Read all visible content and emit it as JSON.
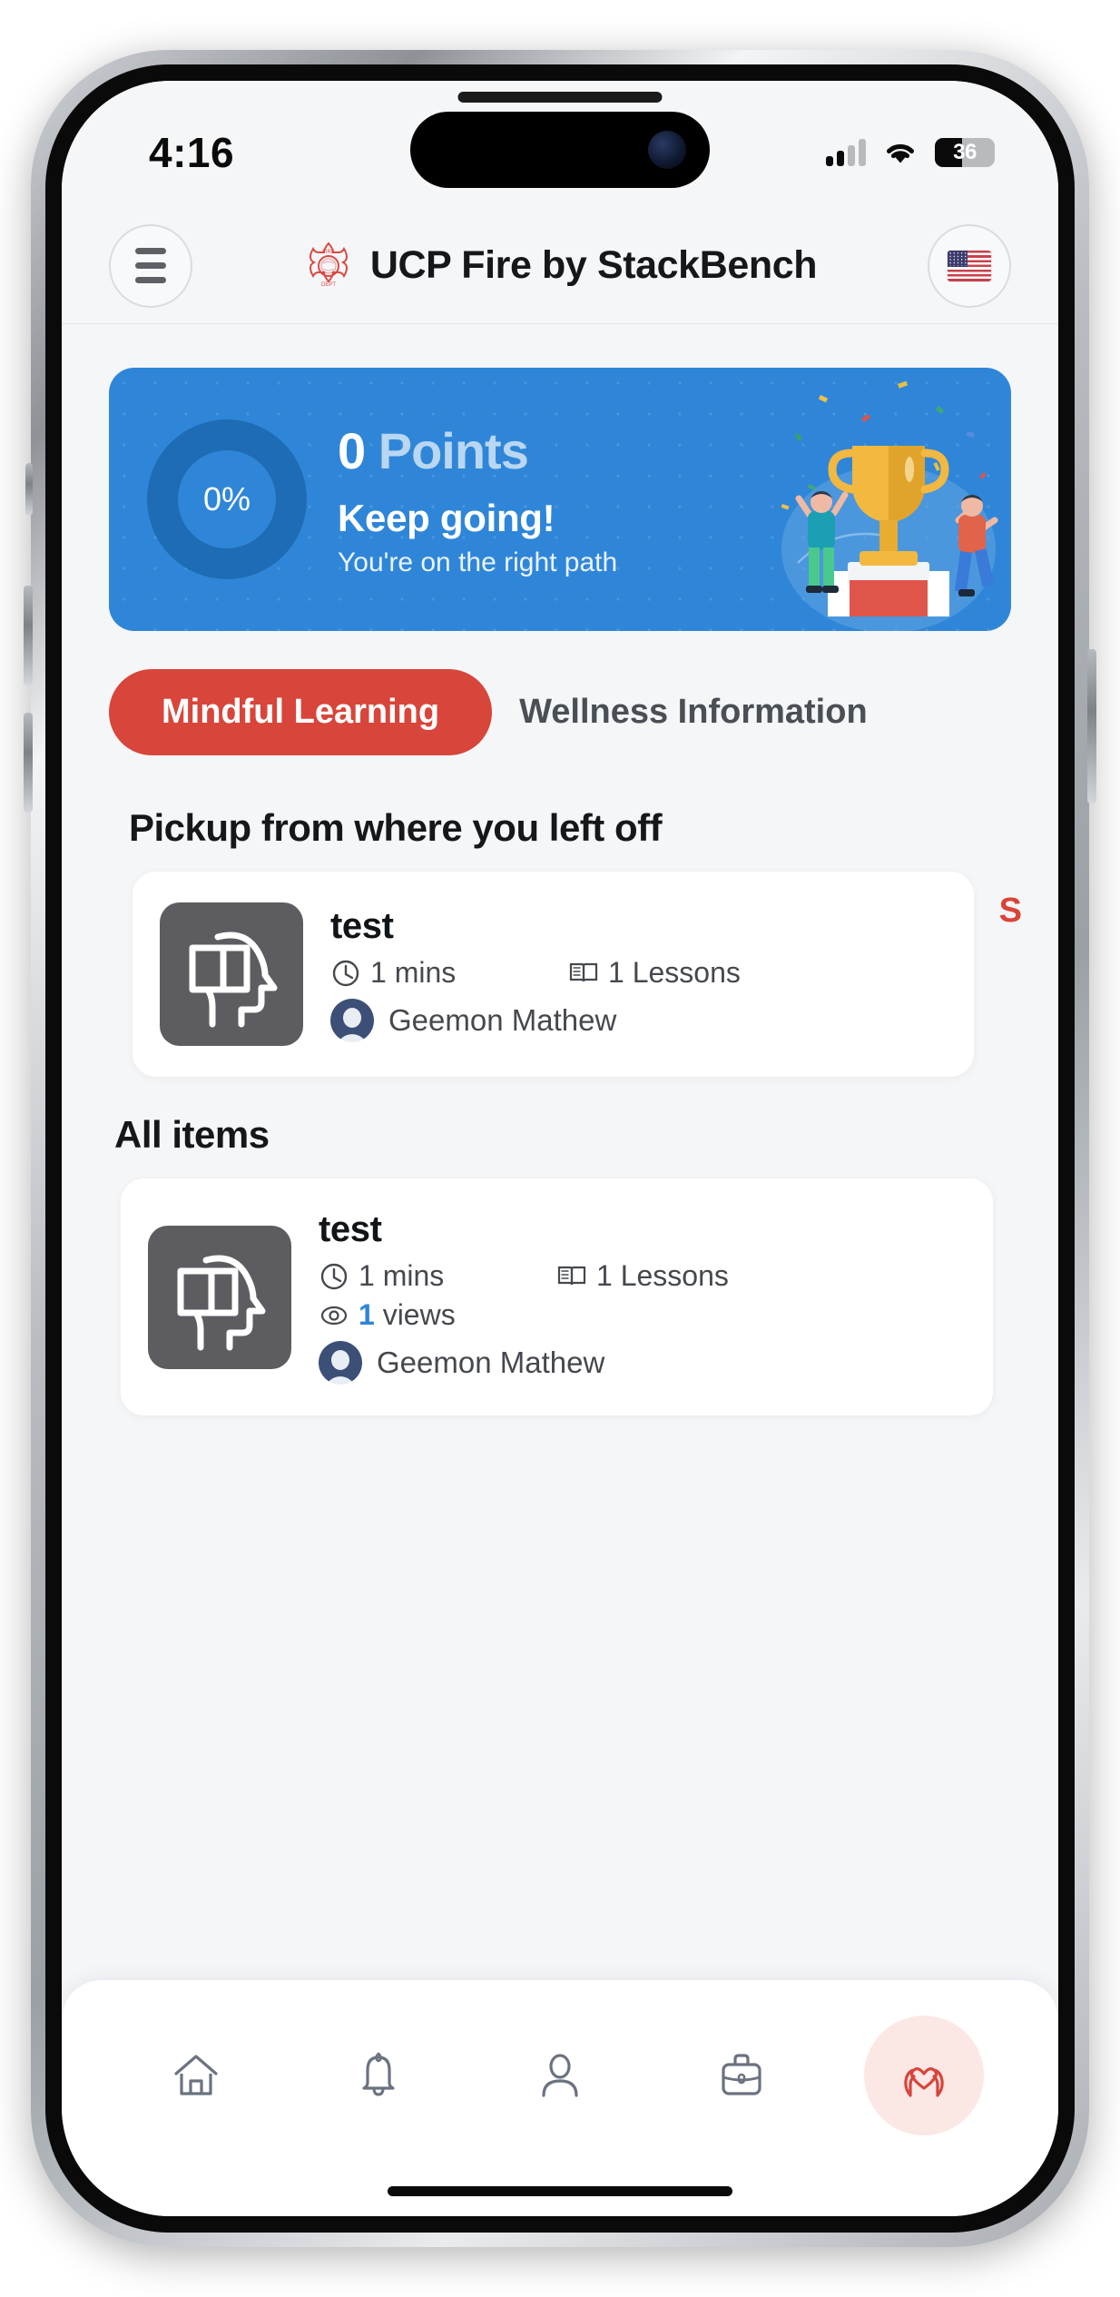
{
  "status_bar": {
    "time": "4:16",
    "signal_icon": "cellular-signal-icon",
    "signal_bars_filled": 2,
    "signal_bars_total": 4,
    "wifi_icon": "wifi-icon",
    "battery_percent": "36",
    "battery_level": 36
  },
  "header": {
    "menu_icon": "hamburger-menu-icon",
    "logo_icon": "fire-department-maltese-cross-logo",
    "title": "UCP Fire by StackBench",
    "language_icon": "us-flag-icon"
  },
  "banner": {
    "progress_label": "0%",
    "progress_value": 0,
    "points_number": "0",
    "points_word": "Points",
    "headline": "Keep going!",
    "subtext": "You're on the right path",
    "illustration": "trophy-celebration-illustration",
    "background_color": "#2f86d8",
    "ring_track_color": "#1d6cb5"
  },
  "tabs": {
    "active_index": 0,
    "items": [
      {
        "label": "Mindful Learning",
        "active": true
      },
      {
        "label": "Wellness Information",
        "active": false
      }
    ],
    "active_color": "#d8453a"
  },
  "sections": [
    {
      "title": "Pickup from where you left off"
    },
    {
      "title": "All items"
    }
  ],
  "pickup_card": {
    "thumbnail_icon": "mindful-learning-head-book-icon",
    "title": "test",
    "duration_icon": "clock-icon",
    "duration": "1 mins",
    "lessons_icon": "book-icon",
    "lessons": "1 Lessons",
    "author_avatar": "user-avatar",
    "author": "Geemon Mathew",
    "overflow_text": "S"
  },
  "all_items_card": {
    "thumbnail_icon": "mindful-learning-head-book-icon",
    "title": "test",
    "duration_icon": "clock-icon",
    "duration": "1 mins",
    "lessons_icon": "book-icon",
    "lessons": "1 Lessons",
    "views_icon": "eye-icon",
    "views_count": "1",
    "views_label": " views",
    "author_avatar": "user-avatar",
    "author": "Geemon Mathew"
  },
  "bottom_nav": {
    "items": [
      {
        "icon": "home-icon",
        "active": false
      },
      {
        "icon": "bell-icon",
        "active": false
      },
      {
        "icon": "person-icon",
        "active": false
      },
      {
        "icon": "briefcase-icon",
        "active": false
      },
      {
        "icon": "hands-holding-heart-icon",
        "active": true
      }
    ],
    "active_color": "#d8453a",
    "inactive_color": "#6b7280"
  }
}
